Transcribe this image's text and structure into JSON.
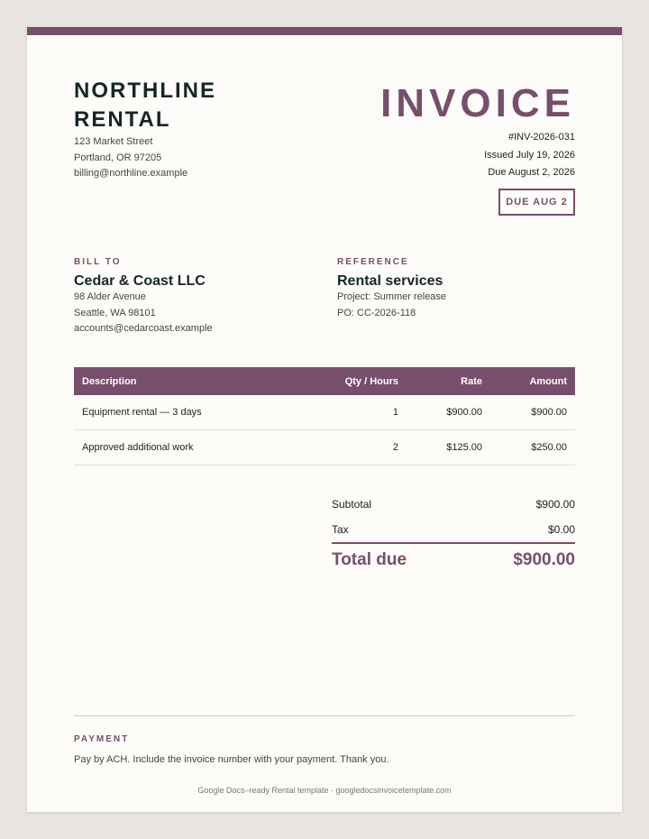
{
  "company": {
    "name": "NORTHLINE RENTAL",
    "address_line1": "123 Market Street",
    "address_line2": "Portland, OR 97205",
    "email": "billing@northline.example"
  },
  "invoice": {
    "title": "INVOICE",
    "number": "#INV-2026-031",
    "issued": "Issued July 19, 2026",
    "due": "Due August 2, 2026",
    "due_badge": "DUE AUG 2"
  },
  "bill_to": {
    "label": "BILL TO",
    "name": "Cedar & Coast LLC",
    "address_line1": "98 Alder Avenue",
    "address_line2": "Seattle, WA 98101",
    "email": "accounts@cedarcoast.example"
  },
  "reference": {
    "label": "REFERENCE",
    "title": "Rental services",
    "project": "Project: Summer release",
    "po": "PO: CC-2026-118"
  },
  "table": {
    "headers": [
      "Description",
      "Qty / Hours",
      "Rate",
      "Amount"
    ],
    "rows": [
      {
        "description": "Equipment rental — 3 days",
        "qty": "1",
        "rate": "$900.00",
        "amount": "$900.00"
      },
      {
        "description": "Approved additional work",
        "qty": "2",
        "rate": "$125.00",
        "amount": "$250.00"
      }
    ]
  },
  "totals": {
    "subtotal_label": "Subtotal",
    "subtotal": "$900.00",
    "tax_label": "Tax",
    "tax": "$0.00",
    "total_label": "Total due",
    "total": "$900.00"
  },
  "payment": {
    "label": "PAYMENT",
    "text": "Pay by ACH. Include the invoice number with your payment. Thank you."
  },
  "footer": {
    "credit": "Google Docs–ready Rental template · googledocsinvoicetemplate.com"
  },
  "colors": {
    "accent": "#774f6c",
    "ink": "#15262a",
    "paper": "#fdfcf8",
    "background": "#e9e6e1"
  }
}
